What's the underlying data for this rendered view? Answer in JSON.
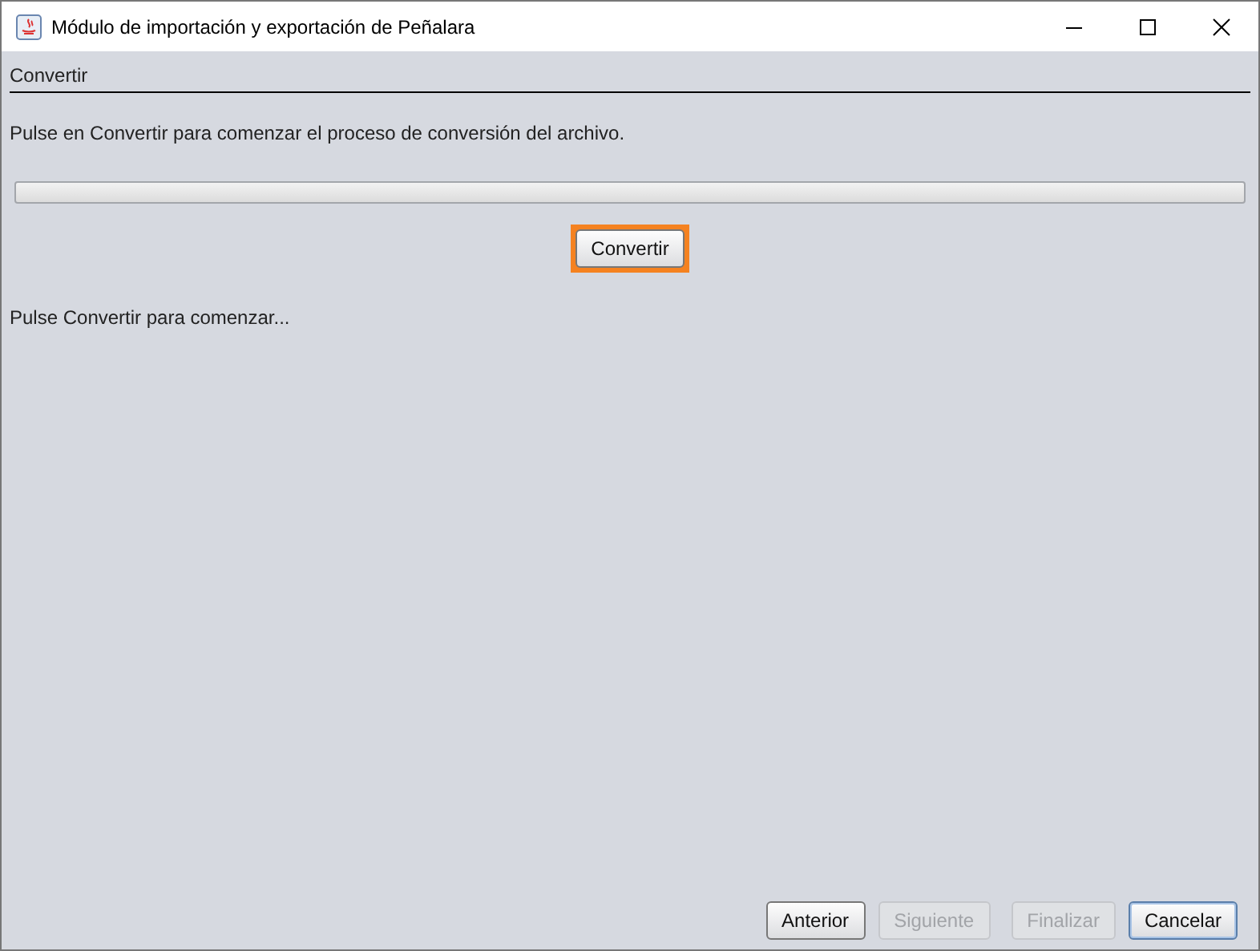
{
  "window": {
    "title": "Módulo de importación y exportación de Peñalara"
  },
  "section_title": "Convertir",
  "instructions": "Pulse en Convertir para comenzar el proceso de conversión del archivo.",
  "progress": {
    "level": 0
  },
  "convert_button": {
    "label": "Convertir",
    "highlighted": true
  },
  "status": "Pulse Convertir para comenzar...",
  "buttons": [
    {
      "label": "Anterior",
      "disabled": false,
      "default": false
    },
    {
      "label": "Siguiente",
      "disabled": true,
      "default": false
    },
    {
      "label": "Finalizar",
      "disabled": true,
      "default": false
    },
    {
      "label": "Cancelar",
      "disabled": false,
      "default": true
    }
  ]
}
